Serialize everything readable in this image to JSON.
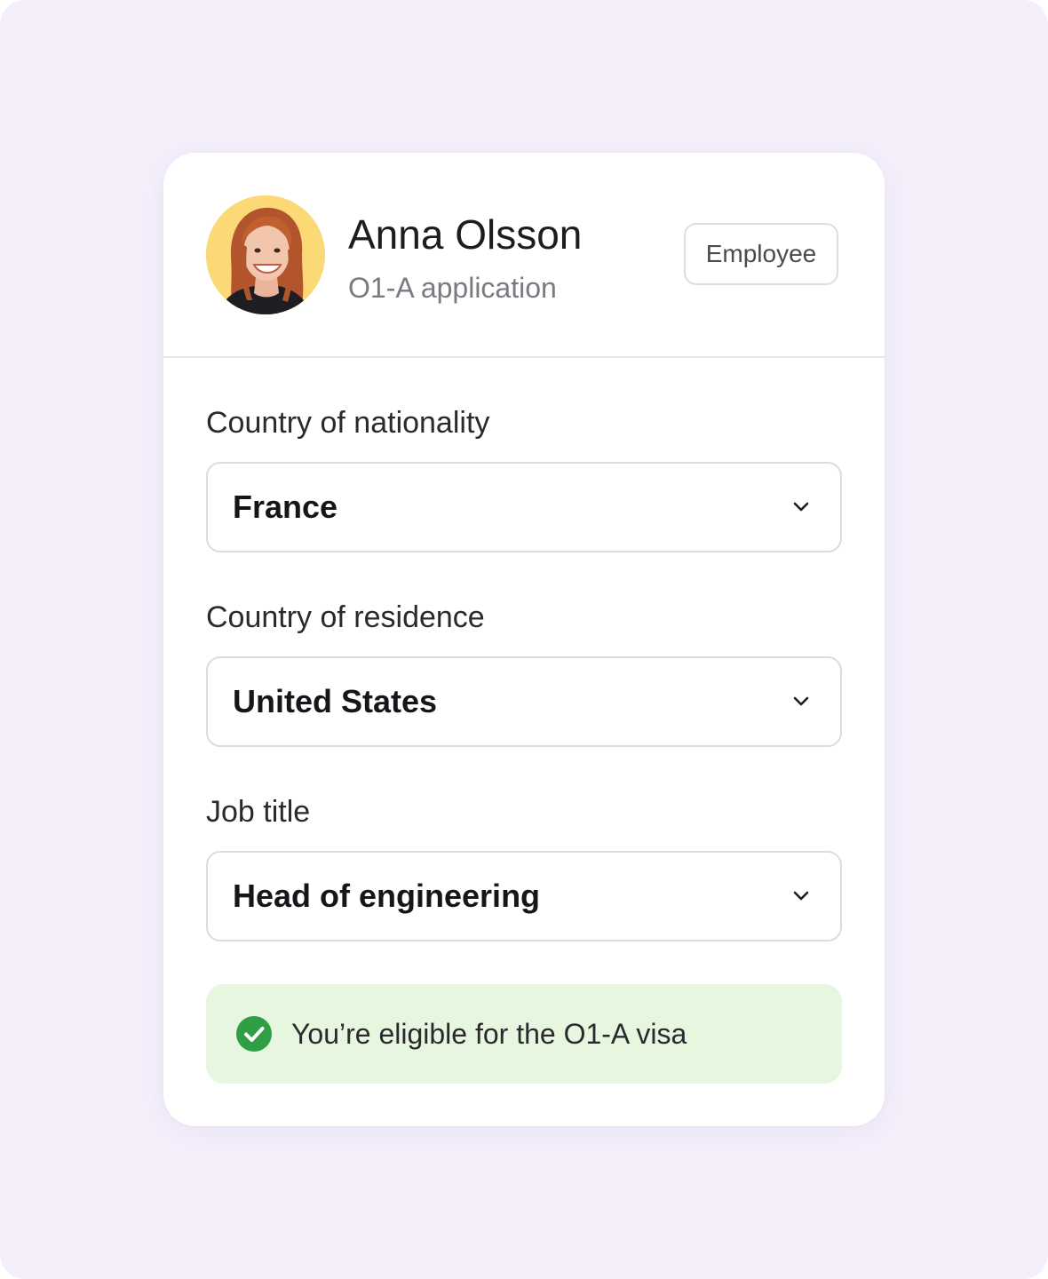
{
  "profile": {
    "name": "Anna Olsson",
    "subtitle": "O1-A application",
    "role_badge": "Employee",
    "avatar_icon": "person-avatar-photo",
    "avatar_bg": "#fbd976"
  },
  "form": {
    "fields": [
      {
        "label": "Country of nationality",
        "value": "France",
        "icon": "chevron-down-icon"
      },
      {
        "label": "Country of residence",
        "value": "United States",
        "icon": "chevron-down-icon"
      },
      {
        "label": "Job title",
        "value": "Head of engineering",
        "icon": "chevron-down-icon"
      }
    ]
  },
  "eligibility": {
    "message": "You’re eligible for the O1-A visa",
    "icon": "check-circle-icon",
    "accent": "#2f9e44",
    "background": "#e6f6df"
  },
  "colors": {
    "page_bg": "#f4effb",
    "card_bg": "#ffffff"
  }
}
